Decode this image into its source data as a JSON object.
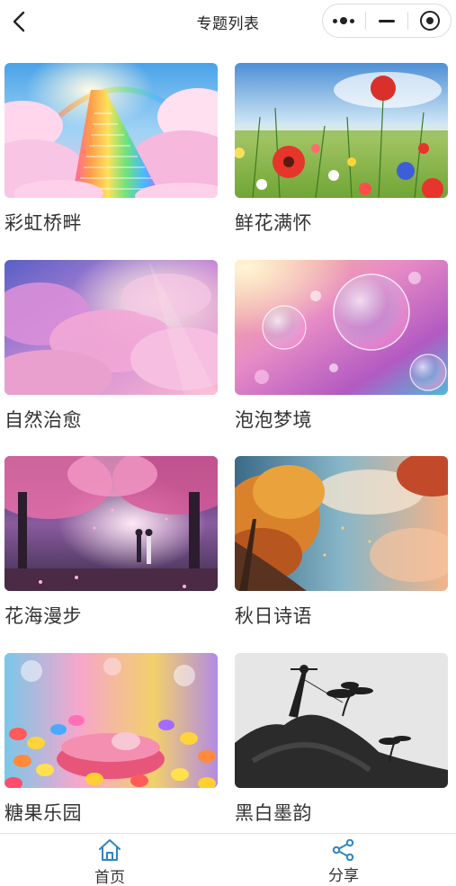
{
  "navbar": {
    "title": "专题列表",
    "back_icon": "chevron-left-icon",
    "capsule": {
      "more_icon": "more-dots-icon",
      "minimize_icon": "minus-icon",
      "close_icon": "target-circle-icon"
    }
  },
  "topics": [
    {
      "title": "彩虹桥畔",
      "image": "rainbow-stairs-clouds"
    },
    {
      "title": "鲜花满怀",
      "image": "wildflower-meadow"
    },
    {
      "title": "自然治愈",
      "image": "pink-clouds-sky"
    },
    {
      "title": "泡泡梦境",
      "image": "bubbles-bokeh"
    },
    {
      "title": "花海漫步",
      "image": "cherry-blossom-couple"
    },
    {
      "title": "秋日诗语",
      "image": "autumn-tree-sky"
    },
    {
      "title": "糖果乐园",
      "image": "jelly-beans-bowl"
    },
    {
      "title": "黑白墨韵",
      "image": "ink-pine-mountain"
    }
  ],
  "tabbar": {
    "home_label": "首页",
    "home_icon": "home-icon",
    "share_label": "分享",
    "share_icon": "share-icon",
    "accent_color": "#2e86c1"
  }
}
